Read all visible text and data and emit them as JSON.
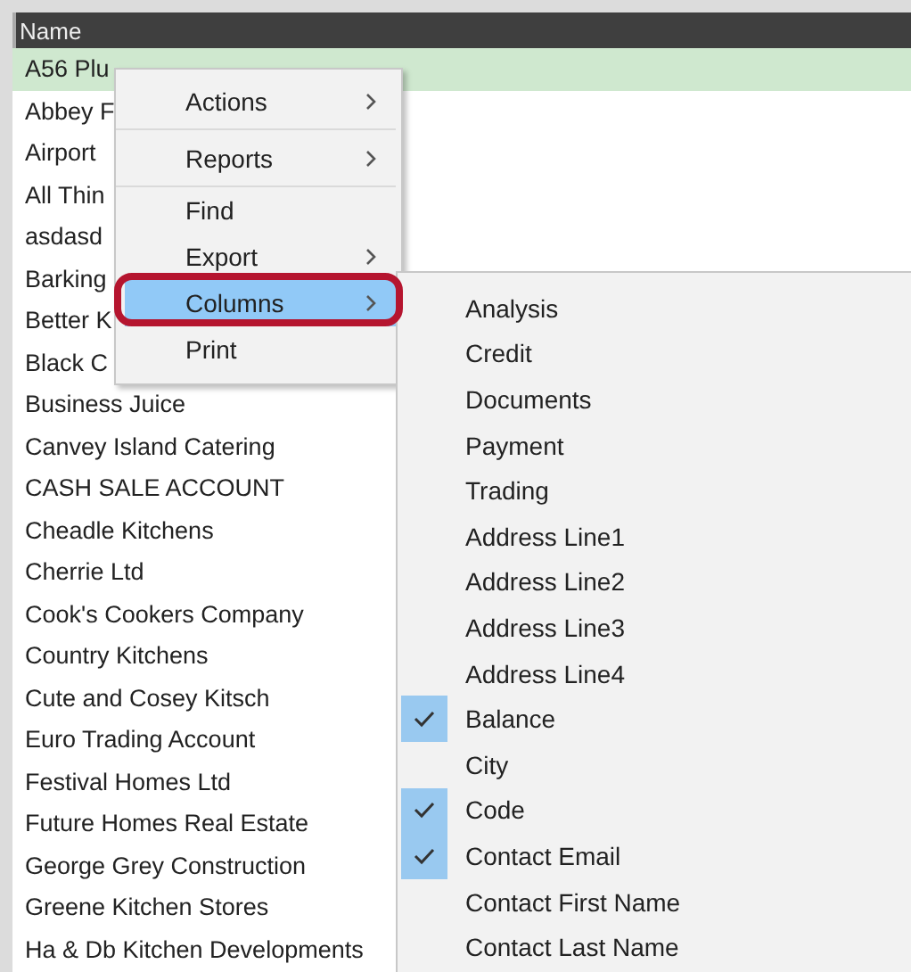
{
  "table": {
    "columns": [
      "Name"
    ],
    "rows": [
      {
        "name": "A56 Plu",
        "selected": true
      },
      {
        "name": "Abbey F",
        "selected": false
      },
      {
        "name": "Airport",
        "selected": false
      },
      {
        "name": "All Thin",
        "selected": false
      },
      {
        "name": "asdasd",
        "selected": false
      },
      {
        "name": "Barking",
        "selected": false
      },
      {
        "name": "Better K",
        "selected": false
      },
      {
        "name": "Black C",
        "selected": false
      },
      {
        "name": "Business Juice",
        "selected": false
      },
      {
        "name": "Canvey Island Catering",
        "selected": false
      },
      {
        "name": "CASH SALE ACCOUNT",
        "selected": false
      },
      {
        "name": "Cheadle Kitchens",
        "selected": false
      },
      {
        "name": "Cherrie Ltd",
        "selected": false
      },
      {
        "name": "Cook's Cookers Company",
        "selected": false
      },
      {
        "name": "Country Kitchens",
        "selected": false
      },
      {
        "name": "Cute and Cosey Kitsch",
        "selected": false
      },
      {
        "name": "Euro Trading Account",
        "selected": false
      },
      {
        "name": "Festival Homes Ltd",
        "selected": false
      },
      {
        "name": "Future Homes Real Estate",
        "selected": false
      },
      {
        "name": "George Grey Construction",
        "selected": false
      },
      {
        "name": "Greene Kitchen Stores",
        "selected": false
      },
      {
        "name": "Ha & Db Kitchen Developments",
        "selected": false
      }
    ]
  },
  "context_menu": {
    "items": [
      {
        "label": "Actions",
        "submenu": true,
        "selected": false,
        "separator_after": true
      },
      {
        "label": "Reports",
        "submenu": true,
        "selected": false,
        "separator_after": true
      },
      {
        "label": "Find",
        "submenu": false,
        "selected": false,
        "separator_after": false
      },
      {
        "label": "Export",
        "submenu": true,
        "selected": false,
        "separator_after": false
      },
      {
        "label": "Columns",
        "submenu": true,
        "selected": true,
        "separator_after": false
      },
      {
        "label": "Print",
        "submenu": false,
        "selected": false,
        "separator_after": false
      }
    ]
  },
  "columns_submenu": {
    "items": [
      {
        "label": "Analysis",
        "checked": false
      },
      {
        "label": "Credit",
        "checked": false
      },
      {
        "label": "Documents",
        "checked": false
      },
      {
        "label": "Payment",
        "checked": false
      },
      {
        "label": "Trading",
        "checked": false
      },
      {
        "label": "Address Line1",
        "checked": false
      },
      {
        "label": "Address Line2",
        "checked": false
      },
      {
        "label": "Address Line3",
        "checked": false
      },
      {
        "label": "Address Line4",
        "checked": false
      },
      {
        "label": "Balance",
        "checked": true
      },
      {
        "label": "City",
        "checked": false
      },
      {
        "label": "Code",
        "checked": true
      },
      {
        "label": "Contact Email",
        "checked": true
      },
      {
        "label": "Contact First Name",
        "checked": false
      },
      {
        "label": "Contact Last Name",
        "checked": false
      }
    ]
  }
}
